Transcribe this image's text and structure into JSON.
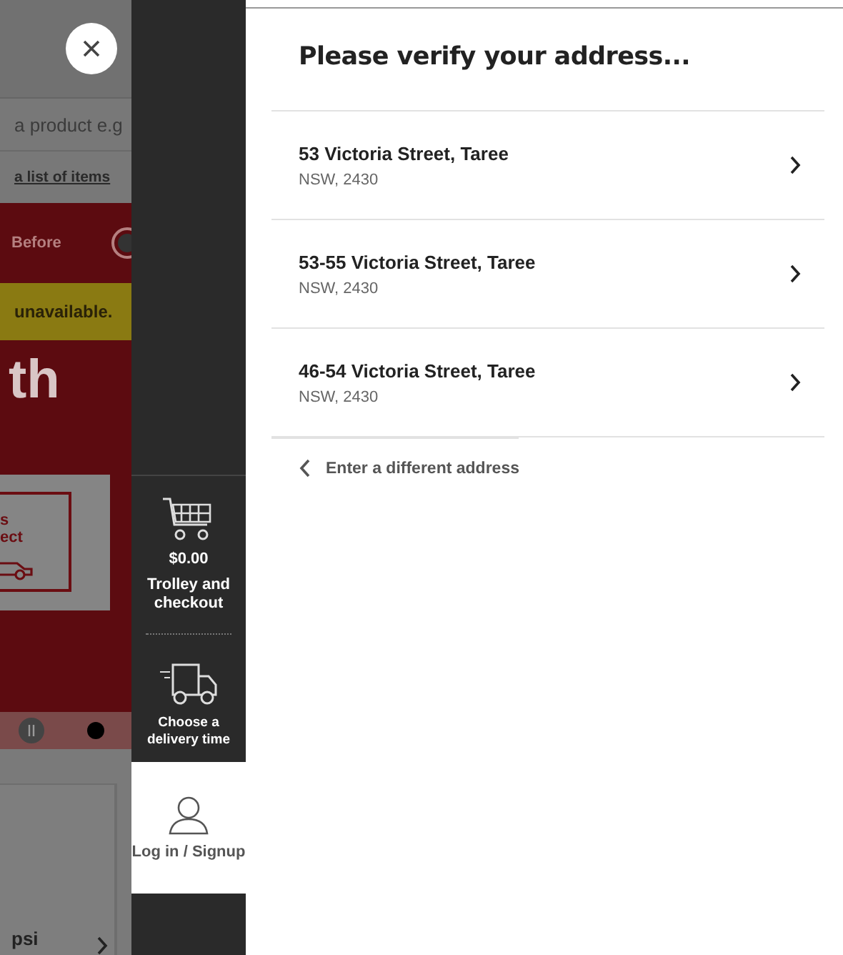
{
  "background_page": {
    "search_placeholder": "a product e.g",
    "list_link": "a list of items",
    "promo_text": "Before",
    "notice": "unavailable.",
    "heading": "th",
    "card_lines": [
      "s",
      "ect"
    ],
    "bottom_text": "psi"
  },
  "sidebar": {
    "trolley": {
      "amount": "$0.00",
      "label": "Trolley and checkout"
    },
    "delivery": {
      "label": "Choose a delivery time"
    },
    "login": {
      "label": "Log in / Signup"
    }
  },
  "panel": {
    "title": "Please verify your address...",
    "addresses": [
      {
        "street": "53 Victoria Street, Taree",
        "region": "NSW, 2430"
      },
      {
        "street": "53-55 Victoria Street, Taree",
        "region": "NSW, 2430"
      },
      {
        "street": "46-54 Victoria Street, Taree",
        "region": "NSW, 2430"
      }
    ],
    "back_link": "Enter a different address"
  }
}
